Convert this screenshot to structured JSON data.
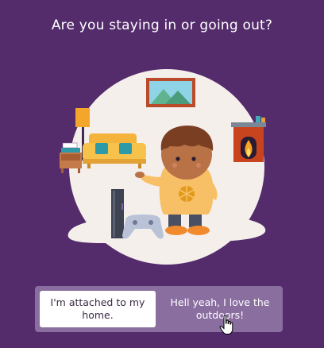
{
  "question": "Are you staying in or going out?",
  "choices": [
    {
      "label": "I'm attached to my home."
    },
    {
      "label": "Hell yeah, I love the outdoors!"
    }
  ],
  "colors": {
    "background": "#542c6b",
    "choice_bar": "#8a6e9f",
    "room_circle": "#f5efec"
  },
  "icons": [
    "room-illustration",
    "hand-pointer-cursor"
  ]
}
